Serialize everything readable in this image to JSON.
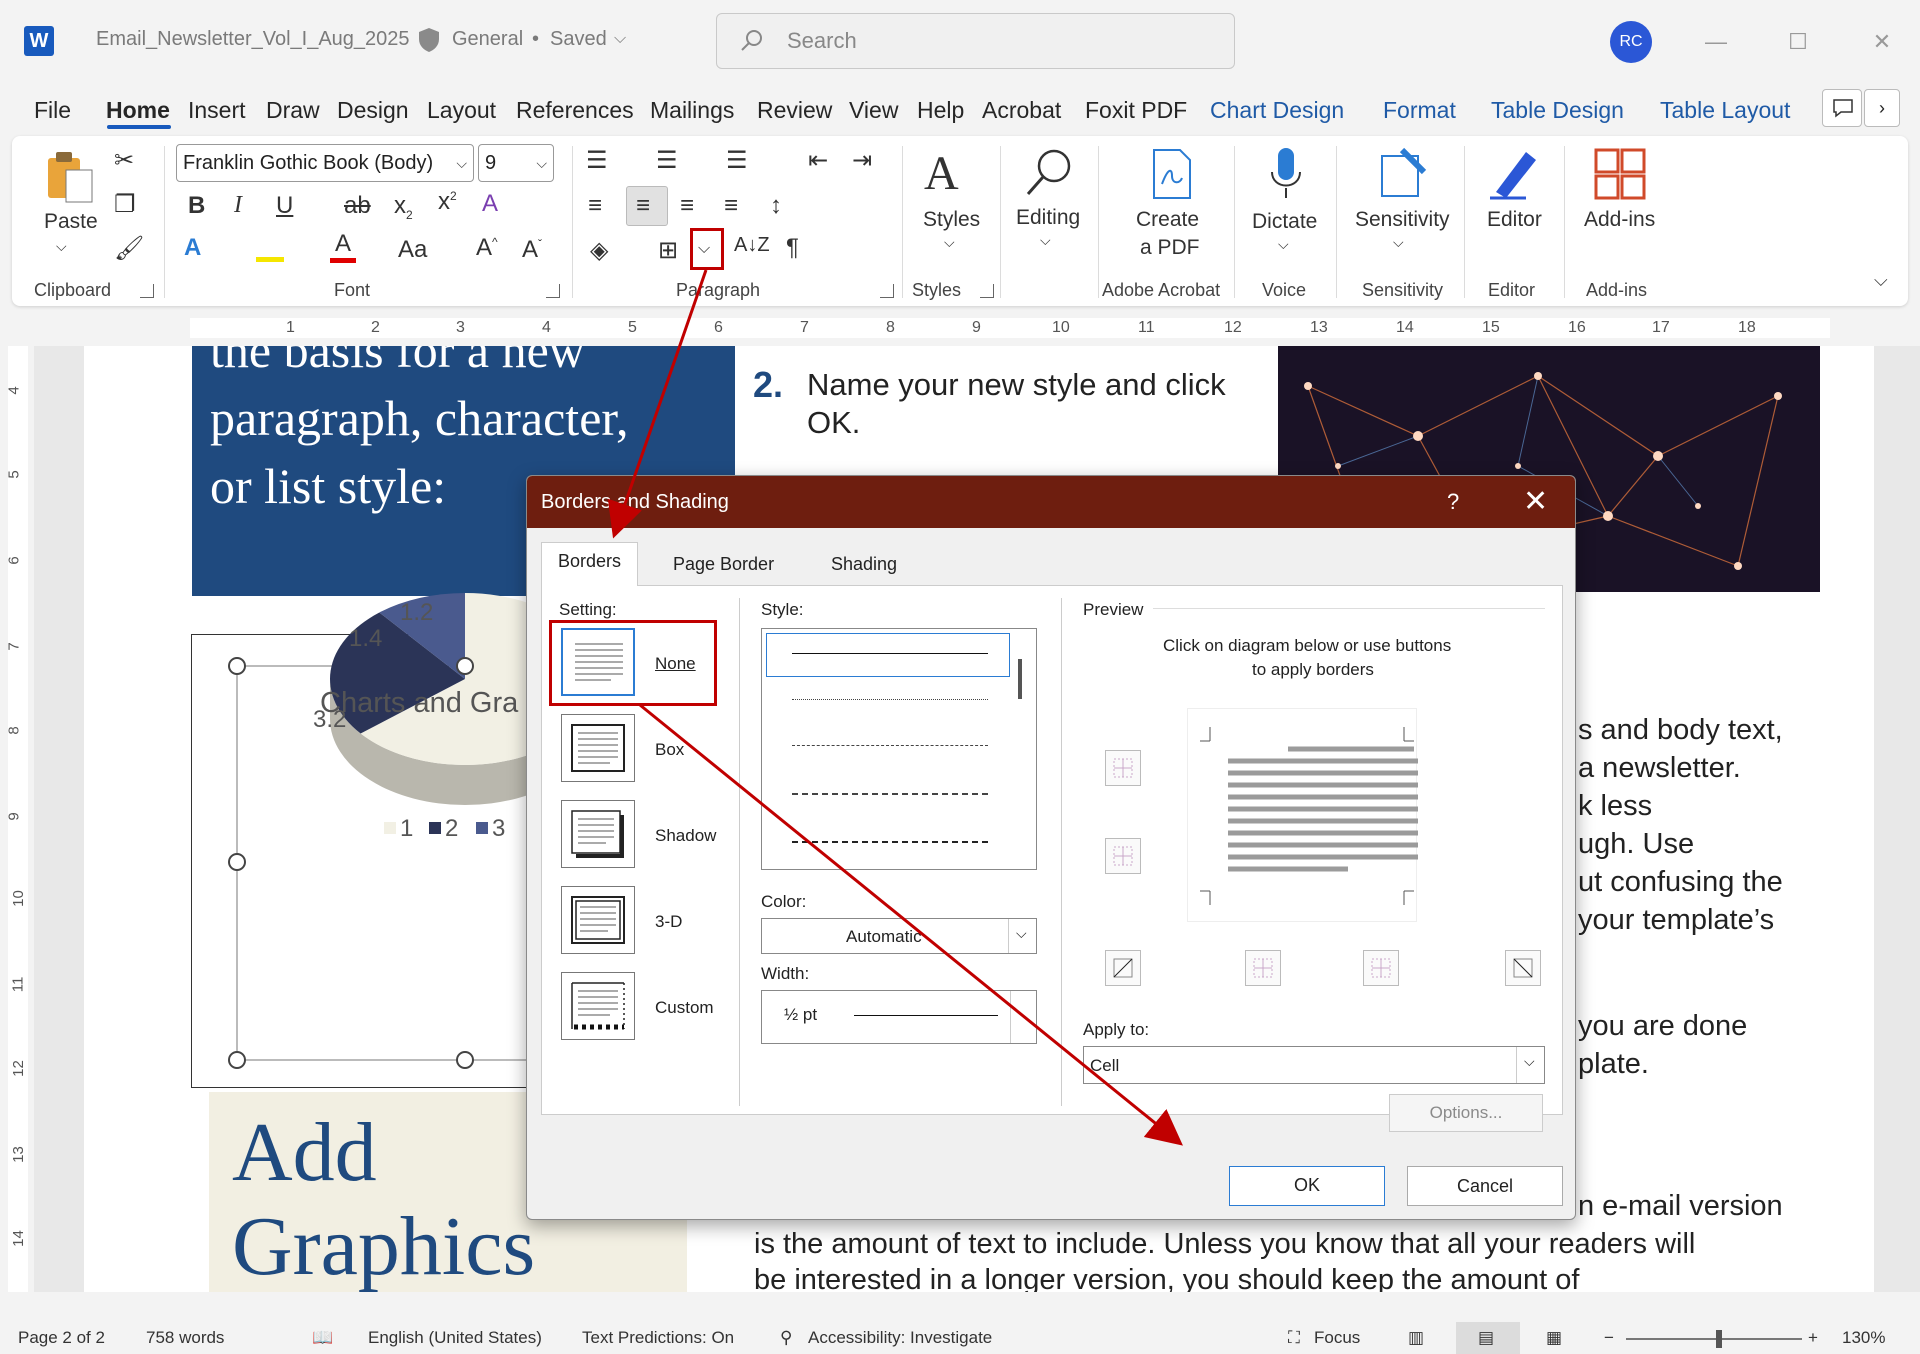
{
  "titlebar": {
    "app_icon": "W",
    "doc_title": "Email_Newsletter_Vol_I_Aug_2025",
    "sensitivity": "General",
    "separator": "•",
    "save_state": "Saved",
    "search_placeholder": "Search",
    "avatar_initials": "RC"
  },
  "tabs": [
    "File",
    "Home",
    "Insert",
    "Draw",
    "Design",
    "Layout",
    "References",
    "Mailings",
    "Review",
    "View",
    "Help",
    "Acrobat",
    "Foxit PDF",
    "Chart Design",
    "Format",
    "Table Design",
    "Table Layout"
  ],
  "ribbon": {
    "clipboard": {
      "paste": "Paste",
      "label": "Clipboard"
    },
    "font": {
      "family": "Franklin Gothic Book (Body)",
      "size": "9",
      "label": "Font"
    },
    "paragraph": {
      "label": "Paragraph"
    },
    "styles": {
      "button": "Styles",
      "label": "Styles"
    },
    "editing": {
      "button": "Editing"
    },
    "adobe": {
      "button_line1": "Create",
      "button_line2": "a PDF",
      "label": "Adobe Acrobat"
    },
    "voice": {
      "button": "Dictate",
      "label": "Voice"
    },
    "sensitivity": {
      "button": "Sensitivity",
      "label": "Sensitivity"
    },
    "editor": {
      "button": "Editor",
      "label": "Editor"
    },
    "addins": {
      "button": "Add-ins",
      "label": "Add-ins"
    }
  },
  "ruler": {
    "h_numbers": [
      "1",
      "2",
      "3",
      "4",
      "5",
      "6",
      "7",
      "8",
      "9",
      "10",
      "11",
      "12",
      "13",
      "14",
      "15",
      "16",
      "17",
      "18"
    ],
    "v_numbers": [
      "4",
      "5",
      "6",
      "7",
      "8",
      "9",
      "10",
      "11",
      "12",
      "13",
      "14"
    ]
  },
  "document": {
    "blue_box_lines": [
      "the basis for a new",
      "paragraph, character,",
      "or list style:"
    ],
    "step_number": "2.",
    "step_text": "Name your new style and click OK.",
    "chart_title": "Charts and Gra",
    "right_lines_1": [
      "s and body text,",
      "a newsletter.",
      "k less",
      "ugh. Use",
      "ut confusing the",
      "your template’s"
    ],
    "right_lines_2": [
      "you are done",
      "plate."
    ],
    "bottom_lines": [
      "n e-mail version",
      "is the amount of text to include. Unless you know that all your readers will",
      "be interested in a longer version, you should keep the amount of"
    ],
    "add_graphics": [
      "Add",
      "Graphics"
    ]
  },
  "chart_data": {
    "type": "pie",
    "title": "Charts and Gra",
    "categories": [
      "1",
      "2",
      "3"
    ],
    "values": [
      8.2,
      3.2,
      1.4
    ],
    "data_labels": [
      "3.2",
      "1.4",
      "1.2"
    ],
    "legend_entries": [
      "1",
      "2",
      "3"
    ],
    "legend": "bottom",
    "colors": [
      "#f2f0e4",
      "#2b3457",
      "#4a5a8e"
    ]
  },
  "dialog": {
    "title": "Borders and Shading",
    "help": "?",
    "close": "✕",
    "tabs": [
      "Borders",
      "Page Border",
      "Shading"
    ],
    "setting_label": "Setting:",
    "settings": [
      "None",
      "Box",
      "Shadow",
      "3-D",
      "Custom"
    ],
    "style_label": "Style:",
    "color_label": "Color:",
    "color_value": "Automatic",
    "width_label": "Width:",
    "width_value": "½ pt",
    "preview_label": "Preview",
    "preview_hint_1": "Click on diagram below or use buttons",
    "preview_hint_2": "to apply borders",
    "apply_to_label": "Apply to:",
    "apply_to_value": "Cell",
    "options_button": "Options...",
    "ok_button": "OK",
    "cancel_button": "Cancel"
  },
  "statusbar": {
    "page": "Page 2 of 2",
    "words": "758 words",
    "language": "English (United States)",
    "predictions": "Text Predictions: On",
    "accessibility": "Accessibility: Investigate",
    "focus": "Focus",
    "zoom": "130%",
    "zoom_minus": "−",
    "zoom_plus": "+"
  },
  "colors": {
    "dialog_title_bg": "#6e1e0f",
    "highlight": "#c00000",
    "doc_blue": "#1f4a7f",
    "context_tab": "#1f5aa6"
  }
}
